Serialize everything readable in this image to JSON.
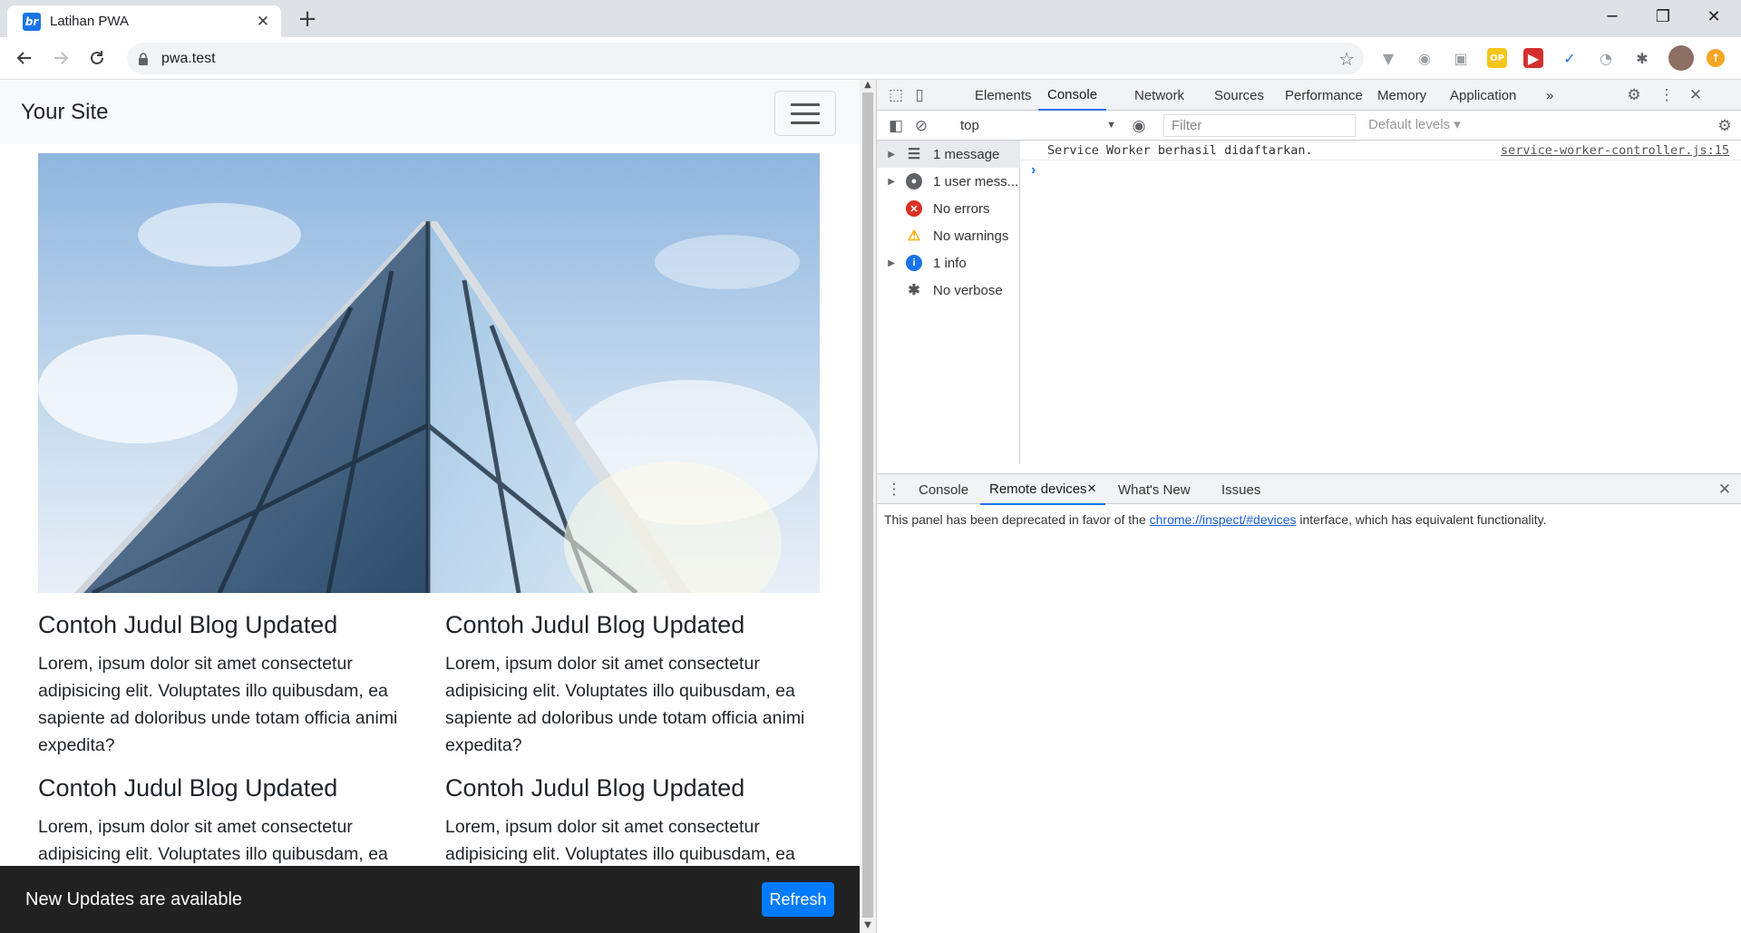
{
  "browser": {
    "tab_title": "Latihan PWA",
    "tab_favicon_text": "br",
    "tab_close": "✕",
    "new_tab": "+",
    "url": "pwa.test",
    "window_controls": {
      "minimize": "─",
      "restore": "❐",
      "close": "✕"
    },
    "extensions": [
      {
        "name": "vue-devtools-icon",
        "glyph": "▼",
        "color": "#9aa0a6"
      },
      {
        "name": "camera-icon",
        "glyph": "◉",
        "color": "#9aa0a6"
      },
      {
        "name": "screenshot-icon",
        "glyph": "▣",
        "color": "#9aa0a6"
      },
      {
        "name": "op-extension-icon",
        "glyph": "OP",
        "color": "#f5c518"
      },
      {
        "name": "red-extension-icon",
        "glyph": "▶",
        "color": "#d32f2f"
      },
      {
        "name": "check-extension-icon",
        "glyph": "✓",
        "color": "#1a73e8"
      },
      {
        "name": "gauge-extension-icon",
        "glyph": "◔",
        "color": "#9aa0a6"
      },
      {
        "name": "puzzle-icon",
        "glyph": "✱",
        "color": "#5f6368"
      }
    ]
  },
  "site": {
    "brand": "Your Site",
    "posts": [
      {
        "title": "Contoh Judul Blog Updated",
        "body": "Lorem, ipsum dolor sit amet consectetur adipisicing elit. Voluptates illo quibusdam, ea sapiente ad doloribus unde totam officia animi expedita?"
      },
      {
        "title": "Contoh Judul Blog Updated",
        "body": "Lorem, ipsum dolor sit amet consectetur adipisicing elit. Voluptates illo quibusdam, ea sapiente ad doloribus unde totam officia animi expedita?"
      },
      {
        "title": "Contoh Judul Blog Updated",
        "body": "Lorem, ipsum dolor sit amet consectetur adipisicing elit. Voluptates illo quibusdam, ea"
      },
      {
        "title": "Contoh Judul Blog Updated",
        "body": "Lorem, ipsum dolor sit amet consectetur adipisicing elit. Voluptates illo quibusdam, ea"
      }
    ],
    "snackbar": {
      "text": "New Updates are available",
      "button": "Refresh"
    }
  },
  "devtools": {
    "tabs": [
      "Elements",
      "Console",
      "Network",
      "Sources",
      "Performance",
      "Memory",
      "Application"
    ],
    "active_tab": "Console",
    "more_tabs": "»",
    "context": "top",
    "filter_placeholder": "Filter",
    "levels": "Default levels ▾",
    "sidebar": [
      {
        "label": "1 message",
        "icon": "list-icon",
        "expandable": true,
        "selected": true
      },
      {
        "label": "1 user mess...",
        "icon": "user-icon",
        "expandable": true,
        "selected": false
      },
      {
        "label": "No errors",
        "icon": "error-icon",
        "expandable": false,
        "selected": false
      },
      {
        "label": "No warnings",
        "icon": "warning-icon",
        "expandable": false,
        "selected": false
      },
      {
        "label": "1 info",
        "icon": "info-icon",
        "expandable": true,
        "selected": false
      },
      {
        "label": "No verbose",
        "icon": "bug-icon",
        "expandable": false,
        "selected": false
      }
    ],
    "log": {
      "message": "Service Worker berhasil didaftarkan.",
      "source": "service-worker-controller.js:15"
    },
    "prompt": "›",
    "drawer": {
      "tabs": [
        "Console",
        "Remote devices",
        "What's New",
        "Issues"
      ],
      "active": "Remote devices",
      "text_before": "This panel has been deprecated in favor of the ",
      "link": "chrome://inspect/#devices",
      "text_after": " interface, which has equivalent functionality."
    }
  },
  "colors": {
    "accent": "#1a73e8",
    "snackbar_bg": "#212121",
    "refresh_button": "#007bff"
  }
}
